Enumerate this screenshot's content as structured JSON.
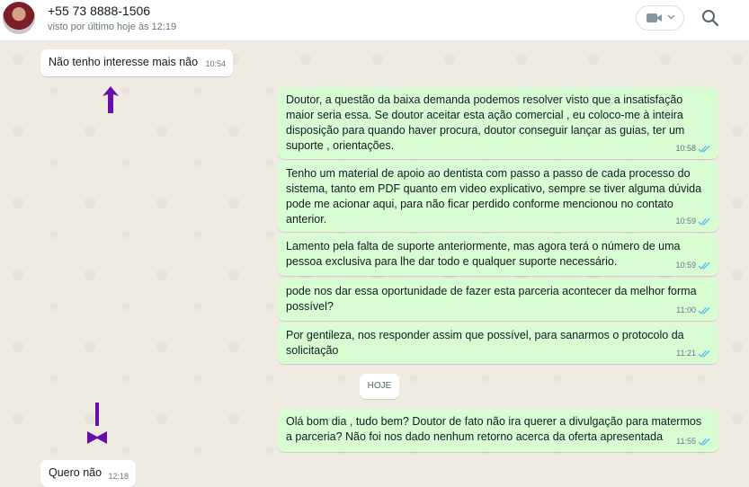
{
  "header": {
    "contact_name": "+55 73 8888-1506",
    "last_seen": "visto por último hoje às 12:19",
    "video_icon": "video-camera-icon",
    "search_icon": "search-icon"
  },
  "colors": {
    "outgoing_bubble": "#d9fdd3",
    "incoming_bubble": "#ffffff",
    "chat_background": "#efeae2",
    "read_ticks": "#53bdeb",
    "annotation_arrow": "#6a0dad"
  },
  "messages": [
    {
      "direction": "in",
      "text": "Não tenho interesse mais não",
      "time": "10:54"
    },
    {
      "direction": "out",
      "text": "Doutor, a questão da baixa demanda podemos resolver visto que a insatisfação maior seria essa. Se doutor aceitar esta ação comercial , eu coloco-me à inteira disposição para quando haver procura, doutor conseguir lançar as guias, ter um suporte , orientações.",
      "time": "10:58"
    },
    {
      "direction": "out",
      "text": "Tenho um material de apoio ao dentista com passo a passo de cada processo do sistema, tanto em PDF quanto em video explicativo, sempre se tiver alguma dúvida pode me acionar aqui, para não ficar perdido conforme mencionou no contato anterior.",
      "time": "10:59"
    },
    {
      "direction": "out",
      "text": "Lamento pela falta de suporte anteriormente, mas agora terá o número de uma pessoa exclusiva para lhe dar todo e qualquer suporte necessário.",
      "time": "10:59"
    },
    {
      "direction": "out",
      "text": "pode nos dar essa oportunidade de fazer esta parceria acontecer da melhor forma possível?",
      "time": "11:00"
    },
    {
      "direction": "out",
      "text": "Por gentileza, nos responder assim que possível, para sanarmos o protocolo da solicitação",
      "time": "11:21"
    },
    {
      "direction": "out",
      "text": "Olá bom dia , tudo bem? Doutor de fato não ira querer a divulgação para matermos a parceria? Não foi nos dado nenhum retorno acerca da oferta apresentada",
      "time": "11:55"
    },
    {
      "direction": "in",
      "text": "Quero não",
      "time": "12:18"
    }
  ],
  "date_divider": "HOJE"
}
